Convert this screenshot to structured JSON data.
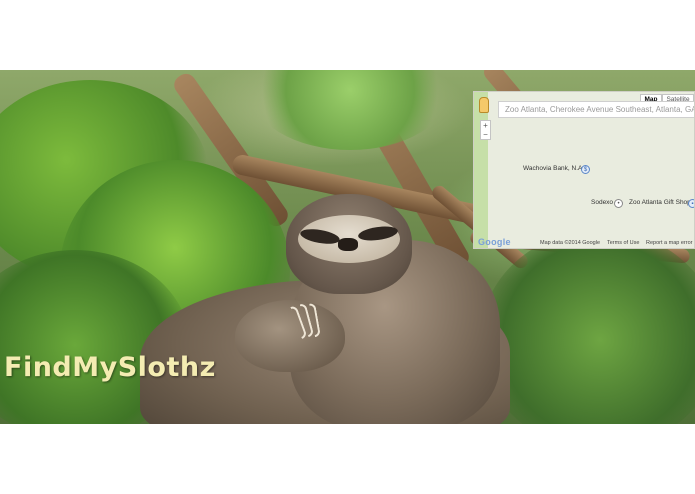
{
  "brand": {
    "title": "FindMySlothz"
  },
  "map": {
    "search_placeholder": "Zoo Atlanta, Cherokee Avenue Southeast, Atlanta, GA",
    "type_buttons": [
      "Map",
      "Satellite"
    ],
    "zoom_in": "+",
    "zoom_out": "−",
    "pois": [
      {
        "label": "Wachovia Bank, N.A",
        "icon": "bank-icon"
      },
      {
        "label": "Sodexo",
        "icon": "place-icon"
      },
      {
        "label": "Zoo Atlanta Gift Shop",
        "icon": "shop-icon"
      }
    ],
    "footer": {
      "logo": "Google",
      "map_data": "Map data ©2014 Google",
      "terms": "Terms of Use",
      "report": "Report a map error"
    }
  },
  "colors": {
    "title_text": "#f4ecb2",
    "map_background": "#e9ecdf"
  }
}
